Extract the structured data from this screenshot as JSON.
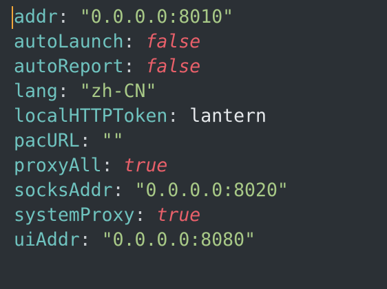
{
  "editor": {
    "lines": [
      {
        "key": "addr",
        "value": "\"0.0.0.0:8010\"",
        "kind": "string"
      },
      {
        "key": "autoLaunch",
        "value": "false",
        "kind": "boolean"
      },
      {
        "key": "autoReport",
        "value": "false",
        "kind": "boolean"
      },
      {
        "key": "lang",
        "value": "\"zh-CN\"",
        "kind": "string"
      },
      {
        "key": "localHTTPToken",
        "value": "lantern",
        "kind": "plain"
      },
      {
        "key": "pacURL",
        "value": "\"\"",
        "kind": "string"
      },
      {
        "key": "proxyAll",
        "value": "true",
        "kind": "boolean"
      },
      {
        "key": "socksAddr",
        "value": "\"0.0.0.0:8020\"",
        "kind": "string"
      },
      {
        "key": "systemProxy",
        "value": "true",
        "kind": "boolean"
      },
      {
        "key": "uiAddr",
        "value": "\"0.0.0.0:8080\"",
        "kind": "string"
      }
    ],
    "separator": ": ",
    "colors": {
      "background": "#2b3035",
      "key": "#6fc3bf",
      "string": "#a8c987",
      "boolean": "#e8606a",
      "plain": "#e6e9ec",
      "cursor": "#f0a63a"
    }
  }
}
